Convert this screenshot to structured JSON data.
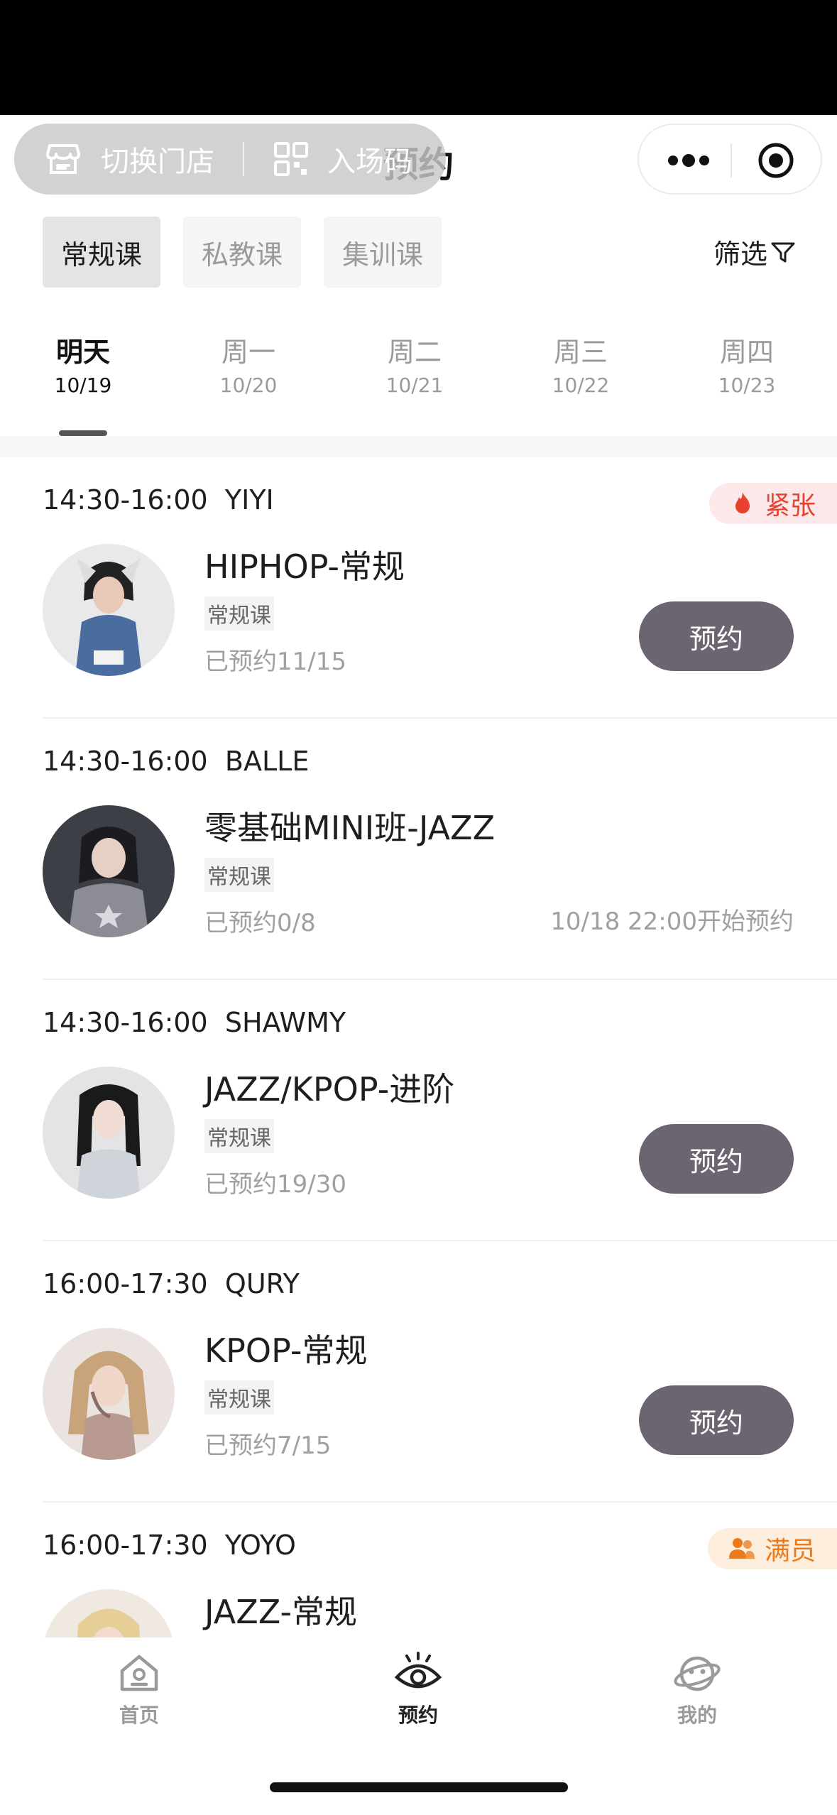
{
  "header": {
    "title": "预约",
    "switch_store": "切换门店",
    "entry_code": "入场码"
  },
  "course_types": [
    "常规课",
    "私教课",
    "集训课"
  ],
  "filter_label": "筛选",
  "dates": [
    {
      "day": "明天",
      "date": "10/19"
    },
    {
      "day": "周一",
      "date": "10/20"
    },
    {
      "day": "周二",
      "date": "10/21"
    },
    {
      "day": "周三",
      "date": "10/22"
    },
    {
      "day": "周四",
      "date": "10/23"
    }
  ],
  "courses": [
    {
      "time": "14:30-16:00",
      "teacher": "YIYI",
      "title": "HIPHOP-常规",
      "type": "常规课",
      "booked": "已预约11/15",
      "button": "预约",
      "badge": "紧张",
      "badge_color": "#e8412f"
    },
    {
      "time": "14:30-16:00",
      "teacher": "BALLE",
      "title": "零基础MINI班-JAZZ",
      "type": "常规课",
      "booked": "已预约0/8",
      "open_time": "10/18 22:00开始预约"
    },
    {
      "time": "14:30-16:00",
      "teacher": "SHAWMY",
      "title": "JAZZ/KPOP-进阶",
      "type": "常规课",
      "booked": "已预约19/30",
      "button": "预约"
    },
    {
      "time": "16:00-17:30",
      "teacher": "QURY",
      "title": "KPOP-常规",
      "type": "常规课",
      "booked": "已预约7/15",
      "button": "预约"
    },
    {
      "time": "16:00-17:30",
      "teacher": "YOYO",
      "title": "JAZZ-常规",
      "badge": "满员",
      "badge_color": "#ec7a1a"
    }
  ],
  "tab_bar": [
    {
      "label": "首页",
      "icon": "home-icon"
    },
    {
      "label": "预约",
      "icon": "eye-icon"
    },
    {
      "label": "我的",
      "icon": "planet-icon"
    }
  ],
  "colors": {
    "button": "#6c6571",
    "hot": "#e8412f",
    "full": "#ec7a1a"
  }
}
